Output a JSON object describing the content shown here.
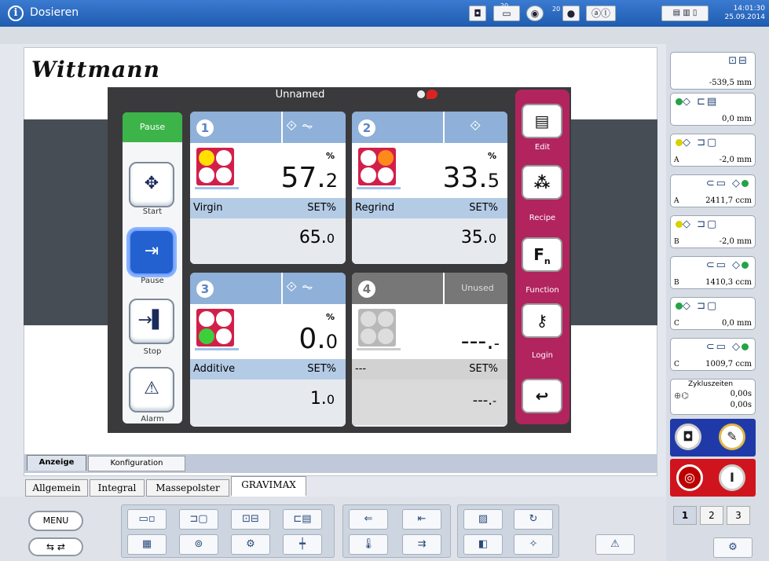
{
  "titlebar": {
    "info_glyph": "i",
    "title": "Dosieren",
    "date": "25.09.2014",
    "time": "14:01:30",
    "badge_a": "20",
    "badge_b": "20"
  },
  "logo": "Wittmann",
  "panel": {
    "title": "Unnamed"
  },
  "left_controls": {
    "status": "Pause",
    "start": "Start",
    "pause": "Pause",
    "stop": "Stop",
    "alarm": "Alarm"
  },
  "cards": [
    {
      "num": "1",
      "value_int": "57.",
      "value_dec": "2",
      "pct": "%",
      "name": "Virgin",
      "set_label": "SET%",
      "set_int": "65.",
      "set_dec": "0",
      "lights": [
        "#ffe000",
        "#fff",
        "#fff",
        "#fff"
      ]
    },
    {
      "num": "2",
      "value_int": "33.",
      "value_dec": "5",
      "pct": "%",
      "name": "Regrind",
      "set_label": "SET%",
      "set_int": "35.",
      "set_dec": "0",
      "lights": [
        "#fff",
        "#ff8a1a",
        "#fff",
        "#fff"
      ]
    },
    {
      "num": "3",
      "value_int": "0.",
      "value_dec": "0",
      "pct": "%",
      "name": "Additive",
      "set_label": "SET%",
      "set_int": "1.",
      "set_dec": "0",
      "lights": [
        "#fff",
        "#fff",
        "#3ccf3c",
        "#fff"
      ]
    },
    {
      "num": "4",
      "status": "Unused",
      "value_int": "---.",
      "value_dec": "-",
      "name": "---",
      "set_label": "SET%",
      "set_int": "---.",
      "set_dec": "-"
    }
  ],
  "right_controls": {
    "edit": "Edit",
    "recipe": "Recipe",
    "function": "Function",
    "login": "Login",
    "fn_glyph": "F"
  },
  "tabs_top": {
    "anzeige": "Anzeige",
    "konfiguration": "Konfiguration"
  },
  "tabs_bottom": {
    "allgemein": "Allgemein",
    "integral": "Integral",
    "massepolster": "Massepolster",
    "gravimax": "GRAVIMAX"
  },
  "menu": "MENU",
  "side": {
    "s1": {
      "value": "-539,5 mm"
    },
    "s2": {
      "value": "0,0 mm"
    },
    "s3": {
      "letter": "A",
      "value": "-2,0 mm"
    },
    "s4": {
      "letter": "A",
      "value": "2411,7 ccm"
    },
    "s5": {
      "letter": "B",
      "value": "-2,0 mm"
    },
    "s6": {
      "letter": "B",
      "value": "1410,3 ccm"
    },
    "s7": {
      "letter": "C",
      "value": "0,0 mm"
    },
    "s8": {
      "letter": "C",
      "value": "1009,7 ccm"
    },
    "zyklus": {
      "label": "Zykluszeiten",
      "v1": "0,00s",
      "v2": "0,00s"
    }
  },
  "pages": [
    "1",
    "2",
    "3"
  ],
  "colors": {
    "titlebar": "#2a68c0",
    "status_green": "#3db449",
    "card_header": "#8fb0d8",
    "lights_red": "#d21f4a",
    "right_panel": "#b1245e"
  }
}
